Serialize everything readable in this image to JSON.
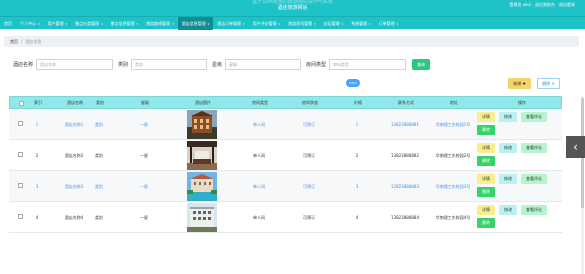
{
  "header": {
    "title_faded": "基于SSM框架的旅游网站设计与实现",
    "title": "酒店旅游网站",
    "user_label": "管理员 ukui",
    "front_link": "退出到前台",
    "logout_link": "退出登录"
  },
  "nav": [
    {
      "label": "首页"
    },
    {
      "label": "个人中心"
    },
    {
      "label": "用户管理"
    },
    {
      "label": "景点分类管理"
    },
    {
      "label": "景点信息管理"
    },
    {
      "label": "旅游路线管理"
    },
    {
      "label": "酒店信息管理"
    },
    {
      "label": "酒店订单管理"
    },
    {
      "label": "用户评论管理"
    },
    {
      "label": "旅游资讯管理"
    },
    {
      "label": "论坛管理"
    },
    {
      "label": "系统管理"
    },
    {
      "label": "订单管理"
    }
  ],
  "breadcrumb": {
    "home": "首页",
    "sep": "/",
    "current": "酒店信息"
  },
  "filters": {
    "name_label": "酒店名称",
    "name_placeholder": "酒店名称",
    "type_label": "类别",
    "type_placeholder": "类别",
    "star_label": "星级",
    "star_placeholder": "星级",
    "room_label": "房间类型",
    "room_placeholder": "房间类型",
    "search_btn": "查询"
  },
  "actions": {
    "add": "新增 ✚",
    "delete": "删除 ✕"
  },
  "badge": "100%",
  "table": {
    "headers": [
      "索引",
      "酒店名称",
      "类别",
      "星级",
      "酒店图片",
      "房间类型",
      "房间状态",
      "价格",
      "联系方式",
      "地址",
      "操作"
    ],
    "rows": [
      {
        "index": "1",
        "name": "酒店名称1",
        "type": "类别",
        "star": "一星",
        "room": "单人间",
        "status": "可预订",
        "price": "1",
        "phone": "13823888881",
        "address": "华南理工东校园1号"
      },
      {
        "index": "2",
        "name": "酒店名称2",
        "type": "类别",
        "star": "一星",
        "room": "单人间",
        "status": "可预订",
        "price": "2",
        "phone": "13823888882",
        "address": "华南理工东校园2号"
      },
      {
        "index": "3",
        "name": "酒店名称3",
        "type": "类别",
        "star": "一星",
        "room": "单人间",
        "status": "可预订",
        "price": "3",
        "phone": "13823888883",
        "address": "华南理工东校园3号"
      },
      {
        "index": "4",
        "name": "酒店名称4",
        "type": "类别",
        "star": "一星",
        "room": "单人间",
        "status": "可预订",
        "price": "4",
        "phone": "13823888884",
        "address": "华南理工东校园4号"
      }
    ],
    "op_labels": {
      "detail": "详情",
      "edit": "修改",
      "review": "查看评论",
      "delete": "删除"
    }
  },
  "colors": {
    "primary": "#1ec3c8",
    "active_nav": "#0e8f94",
    "header_row": "#8fe8e9",
    "link": "#4a8fe0",
    "success": "#36d36a"
  },
  "icons": {
    "side_arrow": "chevron-left-icon"
  }
}
